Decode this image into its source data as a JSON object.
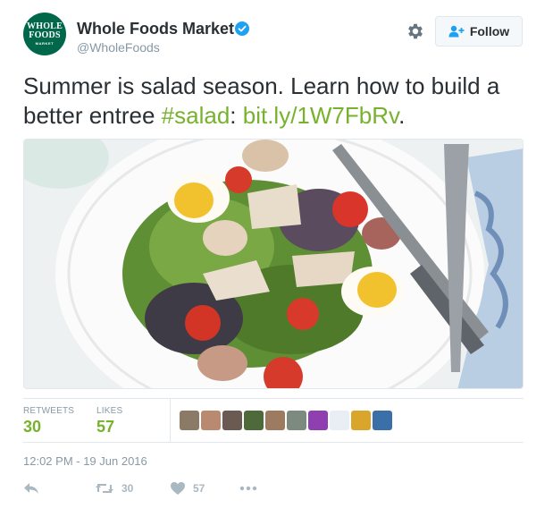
{
  "account": {
    "avatar_lines": [
      "WHOLE",
      "FOODS",
      "MARKET"
    ],
    "display_name": "Whole Foods Market",
    "handle": "@WholeFoods"
  },
  "header": {
    "follow_label": "Follow"
  },
  "tweet": {
    "text_part1": "Summer is salad season. Learn how to build a better entree ",
    "hashtag": "#salad",
    "text_part2": ": ",
    "link": "bit.ly/1W7FbRv",
    "text_part3": "."
  },
  "stats": {
    "retweets_label": "RETWEETS",
    "retweets_value": "30",
    "likes_label": "LIKES",
    "likes_value": "57"
  },
  "timestamp": "12:02 PM - 19 Jun 2016",
  "actions": {
    "retweet_count": "30",
    "like_count": "57"
  },
  "colors": {
    "accent": "#77b22e",
    "brand_green": "#00674b",
    "verified_blue": "#1da1f2",
    "muted": "#8899a6"
  },
  "icons": [
    "verified-icon",
    "gear-icon",
    "follow-person-icon",
    "reply-icon",
    "retweet-icon",
    "heart-icon",
    "more-icon"
  ]
}
